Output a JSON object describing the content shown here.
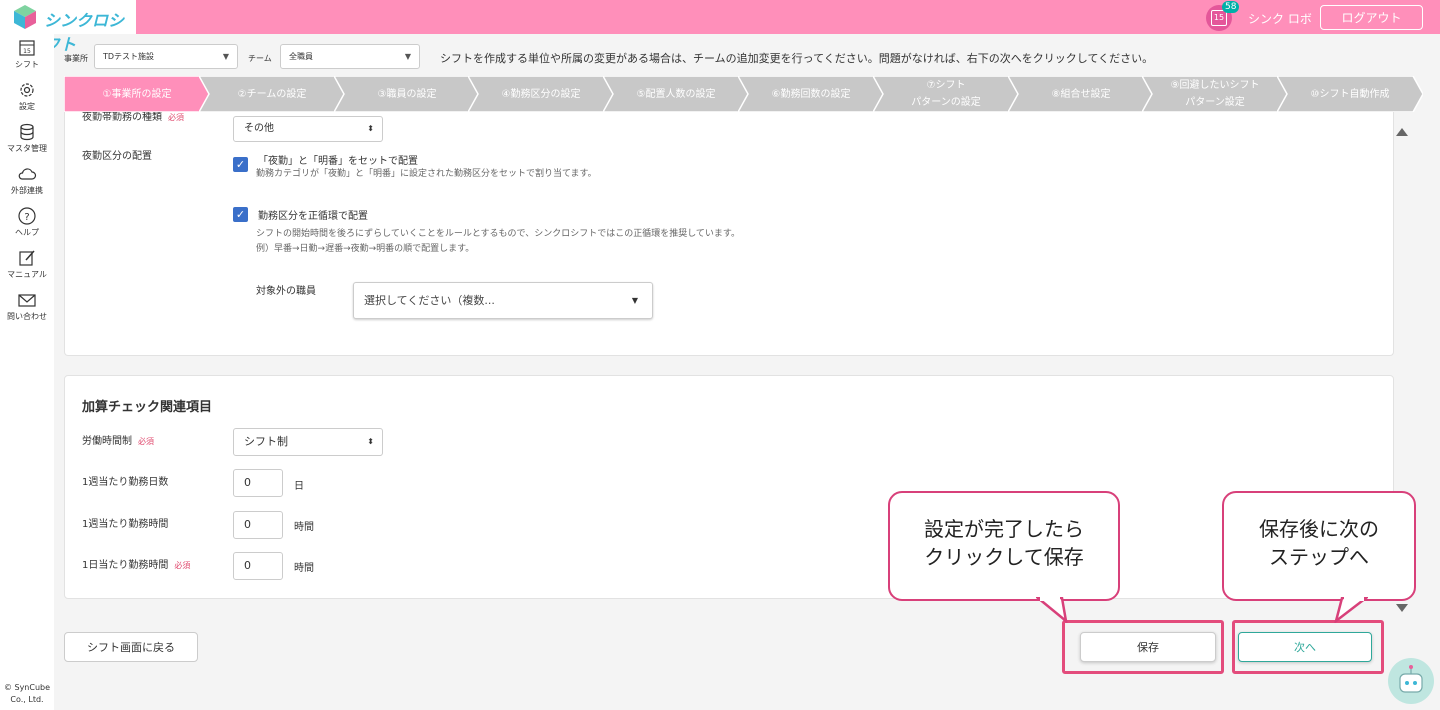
{
  "header": {
    "logo_text": "シンクロシフト",
    "calendar_day": "15",
    "notification_count": "58",
    "user_name": "シンク ロボ",
    "logout_label": "ログアウト"
  },
  "sidebar": {
    "items": [
      {
        "label": "シフト",
        "icon": "calendar-icon"
      },
      {
        "label": "設定",
        "icon": "gear-icon"
      },
      {
        "label": "マスタ管理",
        "icon": "database-icon"
      },
      {
        "label": "外部連携",
        "icon": "cloud-icon"
      },
      {
        "label": "ヘルプ",
        "icon": "help-icon"
      },
      {
        "label": "マニュアル",
        "icon": "edit-icon"
      },
      {
        "label": "問い合わせ",
        "icon": "mail-icon"
      }
    ],
    "copyright": "© SynCube Co., Ltd."
  },
  "filters": {
    "office_label": "事業所",
    "office_value": "TDテスト施設",
    "team_label": "チーム",
    "team_value": "全職員",
    "notice": "シフトを作成する単位や所属の変更がある場合は、チームの追加変更を行ってください。問題がなければ、右下の次へをクリックしてください。"
  },
  "steps": [
    {
      "label": "①事業所の設定",
      "active": true
    },
    {
      "label": "②チームの設定",
      "active": false
    },
    {
      "label": "③職員の設定",
      "active": false
    },
    {
      "label": "④勤務区分の設定",
      "active": false
    },
    {
      "label": "⑤配置人数の設定",
      "active": false
    },
    {
      "label": "⑥勤務回数の設定",
      "active": false
    },
    {
      "label": "⑦シフト\nパターンの設定",
      "active": false
    },
    {
      "label": "⑧組合せ設定",
      "active": false
    },
    {
      "label": "⑨回避したいシフト\nパターン設定",
      "active": false
    },
    {
      "label": "⑩シフト自動作成",
      "active": false
    }
  ],
  "colors": {
    "header_pink": "#ff8fba",
    "active_step": "#ff8fba",
    "inactive_step": "#c8c8c8",
    "checkbox_blue": "#3a6fc9",
    "highlight_red": "#e34c7c",
    "next_teal": "#2fa89a"
  },
  "panel1": {
    "cut_label": "夜勤帯勤務の種類",
    "cut_required": "必須",
    "cut_select": "その他",
    "night_label": "夜勤区分の配置",
    "check1_label": "「夜勤」と「明番」をセットで配置",
    "check1_desc": "勤務カテゴリが「夜勤」と「明番」に設定された勤務区分をセットで割り当てます。",
    "check2_label": "勤務区分を正循環で配置",
    "check2_desc1": "シフトの開始時間を後ろにずらしていくことをルールとするもので、シンクロシフトではこの正循環を推奨しています。",
    "check2_desc2": "例）早番→日勤→遅番→夜勤→明番の順で配置します。",
    "exclude_label": "対象外の職員",
    "exclude_placeholder": "選択してください（複数..."
  },
  "panel2": {
    "title": "加算チェック関連項目",
    "labor_label": "労働時間制",
    "labor_required": "必須",
    "labor_value": "シフト制",
    "days_label": "1週当たり勤務日数",
    "days_value": "0",
    "days_unit": "日",
    "week_hours_label": "1週当たり勤務時間",
    "week_hours_value": "0",
    "week_hours_unit": "時間",
    "day_hours_label": "1日当たり勤務時間",
    "day_hours_required": "必須",
    "day_hours_value": "0",
    "day_hours_unit": "時間"
  },
  "footer": {
    "back_label": "シフト画面に戻る",
    "save_label": "保存",
    "next_label": "次へ"
  },
  "callouts": {
    "save_line1": "設定が完了したら",
    "save_line2": "クリックして保存",
    "next_line1": "保存後に次の",
    "next_line2": "ステップへ"
  }
}
